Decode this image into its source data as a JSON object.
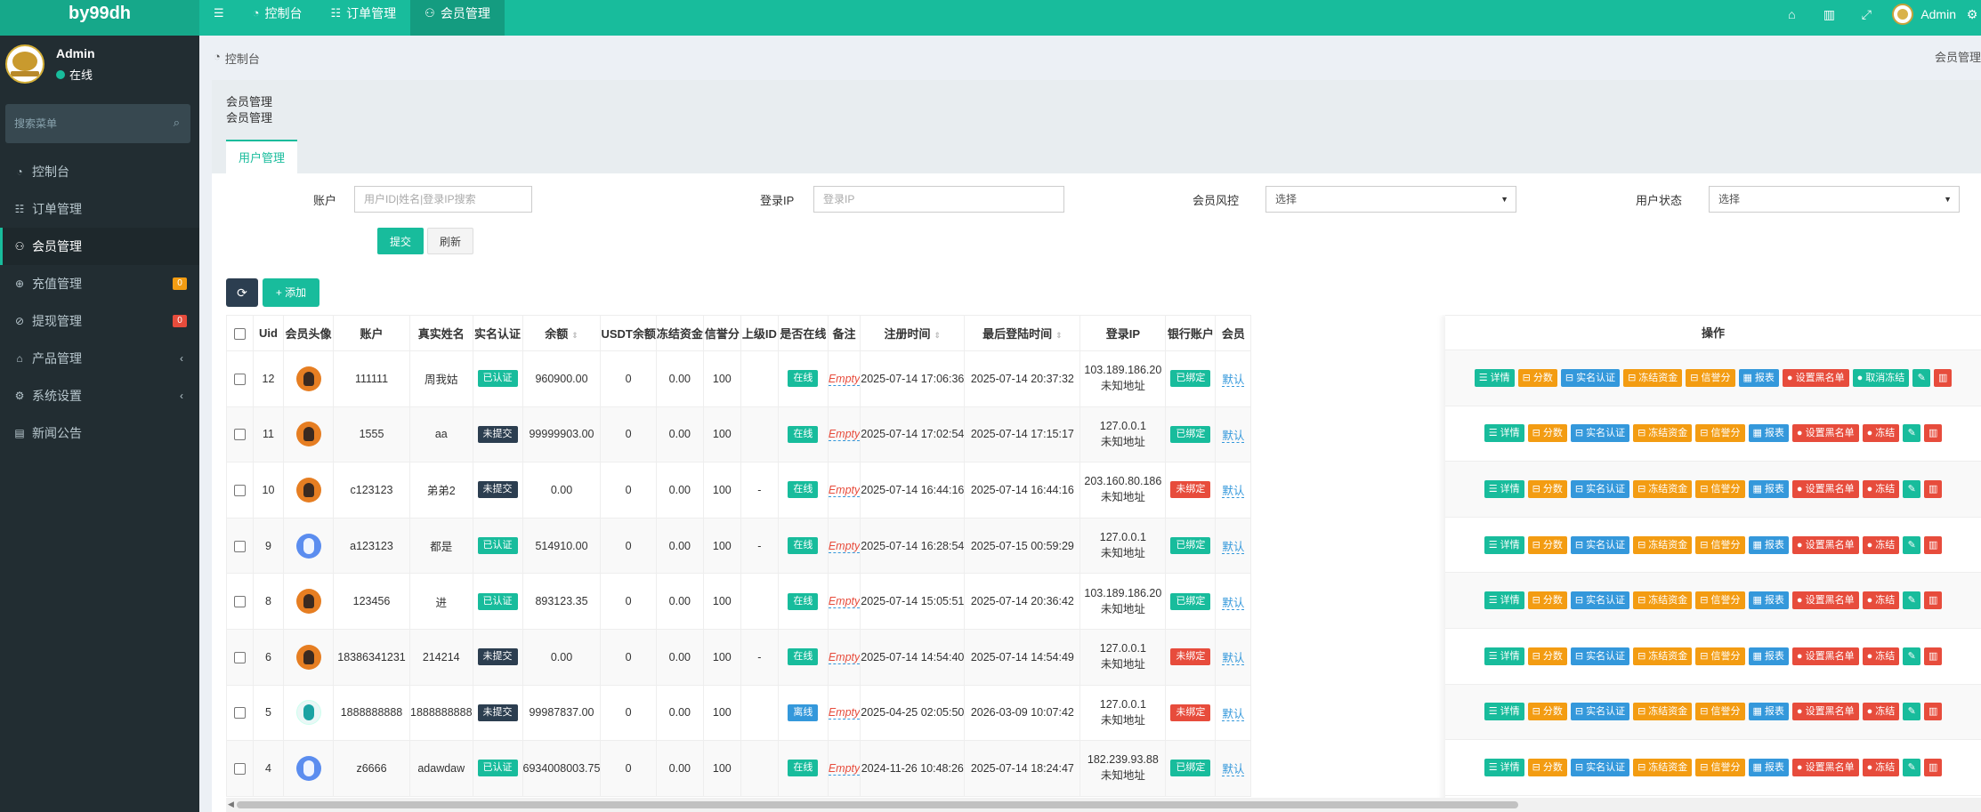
{
  "brand": "by99dh",
  "topnav": [
    {
      "icon": "☰",
      "label": ""
    },
    {
      "icon": "◔",
      "label": "控制台"
    },
    {
      "icon": "☷",
      "label": "订单管理"
    },
    {
      "icon": "👥",
      "label": "会员管理"
    }
  ],
  "topright": {
    "user": "Admin"
  },
  "sidebar": {
    "user_name": "Admin",
    "user_status": "在线",
    "search_placeholder": "搜索菜单",
    "items": [
      {
        "label": "控制台"
      },
      {
        "label": "订单管理"
      },
      {
        "label": "会员管理"
      },
      {
        "label": "充值管理",
        "badge": "0",
        "badge_color": "#f39c12"
      },
      {
        "label": "提现管理",
        "badge": "0",
        "badge_color": "#e74c3c"
      },
      {
        "label": "产品管理"
      },
      {
        "label": "系统设置"
      },
      {
        "label": "新闻公告"
      }
    ]
  },
  "breadcrumb": {
    "home": "控制台",
    "right": "会员管理"
  },
  "panel": {
    "title1": "会员管理",
    "title2": "会员管理",
    "tab": "用户管理"
  },
  "filters": {
    "account_label": "账户",
    "account_placeholder": "用户ID|姓名|登录IP搜索",
    "ip_label": "登录IP",
    "ip_placeholder": "登录IP",
    "risk_label": "会员风控",
    "risk_value": "选择",
    "status_label": "用户状态",
    "status_value": "选择",
    "submit": "提交",
    "reset": "刷新"
  },
  "toolbar": {
    "add": "添加"
  },
  "table": {
    "headers": [
      "Uid",
      "会员头像",
      "账户",
      "真实姓名",
      "实名认证",
      "余额",
      "USDT余额",
      "冻结资金",
      "信誉分",
      "上级ID",
      "是否在线",
      "备注",
      "注册时间",
      "最后登陆时间",
      "登录IP",
      "银行账户",
      "会员"
    ],
    "ops_header": "操作",
    "rows": [
      {
        "uid": "12",
        "avatar": "orange",
        "account": "111111",
        "name": "周我姑",
        "verify": "已认证",
        "balance": "960900.00",
        "usdt": "0",
        "frozen": "0.00",
        "credit": "100",
        "parent": "",
        "online": "在线",
        "note": "Empty",
        "reg": "2025-07-14 17:06:36",
        "last": "2025-07-14 20:37:32",
        "ip1": "103.189.186.20",
        "ip2": "未知地址",
        "bank": "已绑定",
        "member": "默认",
        "unfreeze": "取消冻结"
      },
      {
        "uid": "11",
        "avatar": "orange",
        "account": "1555",
        "name": "aa",
        "verify": "未提交",
        "balance": "99999903.00",
        "usdt": "0",
        "frozen": "0.00",
        "credit": "100",
        "parent": "",
        "online": "在线",
        "note": "Empty",
        "reg": "2025-07-14 17:02:54",
        "last": "2025-07-14 17:15:17",
        "ip1": "127.0.0.1",
        "ip2": "未知地址",
        "bank": "已绑定",
        "member": "默认",
        "unfreeze": "冻结"
      },
      {
        "uid": "10",
        "avatar": "orange",
        "account": "c123123",
        "name": "弟弟2",
        "verify": "未提交",
        "balance": "0.00",
        "usdt": "0",
        "frozen": "0.00",
        "credit": "100",
        "parent": "-",
        "online": "在线",
        "note": "Empty",
        "reg": "2025-07-14 16:44:16",
        "last": "2025-07-14 16:44:16",
        "ip1": "203.160.80.186",
        "ip2": "未知地址",
        "bank": "未绑定",
        "member": "默认",
        "unfreeze": "冻结"
      },
      {
        "uid": "9",
        "avatar": "blue",
        "account": "a123123",
        "name": "都是",
        "verify": "已认证",
        "balance": "514910.00",
        "usdt": "0",
        "frozen": "0.00",
        "credit": "100",
        "parent": "-",
        "online": "在线",
        "note": "Empty",
        "reg": "2025-07-14 16:28:54",
        "last": "2025-07-15 00:59:29",
        "ip1": "127.0.0.1",
        "ip2": "未知地址",
        "bank": "已绑定",
        "member": "默认",
        "unfreeze": "冻结"
      },
      {
        "uid": "8",
        "avatar": "orange",
        "account": "123456",
        "name": "进",
        "verify": "已认证",
        "balance": "893123.35",
        "usdt": "0",
        "frozen": "0.00",
        "credit": "100",
        "parent": "",
        "online": "在线",
        "note": "Empty",
        "reg": "2025-07-14 15:05:51",
        "last": "2025-07-14 20:36:42",
        "ip1": "103.189.186.20",
        "ip2": "未知地址",
        "bank": "已绑定",
        "member": "默认",
        "unfreeze": "冻结"
      },
      {
        "uid": "6",
        "avatar": "orange",
        "account": "18386341231",
        "name": "214214",
        "verify": "未提交",
        "balance": "0.00",
        "usdt": "0",
        "frozen": "0.00",
        "credit": "100",
        "parent": "-",
        "online": "在线",
        "note": "Empty",
        "reg": "2025-07-14 14:54:40",
        "last": "2025-07-14 14:54:49",
        "ip1": "127.0.0.1",
        "ip2": "未知地址",
        "bank": "未绑定",
        "member": "默认",
        "unfreeze": "冻结"
      },
      {
        "uid": "5",
        "avatar": "teal",
        "account": "1888888888",
        "name": "1888888888",
        "verify": "未提交",
        "balance": "99987837.00",
        "usdt": "0",
        "frozen": "0.00",
        "credit": "100",
        "parent": "",
        "online": "离线",
        "note": "Empty",
        "reg": "2025-04-25 02:05:50",
        "last": "2026-03-09 10:07:42",
        "ip1": "127.0.0.1",
        "ip2": "未知地址",
        "bank": "未绑定",
        "member": "默认",
        "unfreeze": "冻结"
      },
      {
        "uid": "4",
        "avatar": "blue",
        "account": "z6666",
        "name": "adawdaw",
        "verify": "已认证",
        "balance": "6934008003.75",
        "usdt": "0",
        "frozen": "0.00",
        "credit": "100",
        "parent": "",
        "online": "在线",
        "note": "Empty",
        "reg": "2024-11-26 10:48:26",
        "last": "2025-07-14 18:24:47",
        "ip1": "182.239.93.88",
        "ip2": "未知地址",
        "bank": "已绑定",
        "member": "默认",
        "unfreeze": "冻结"
      }
    ],
    "op_buttons": {
      "detail": "详情",
      "points": "分数",
      "verify": "实名认证",
      "freeze_funds": "冻结资金",
      "credit": "信誉分",
      "report": "报表",
      "blacklist": "设置黑名单"
    }
  },
  "colors": {
    "primary": "#18bc9c",
    "sidebar": "#222d32",
    "dark": "#2c3e50",
    "danger": "#e74c3c",
    "warning": "#f39c12",
    "info": "#3498db"
  }
}
